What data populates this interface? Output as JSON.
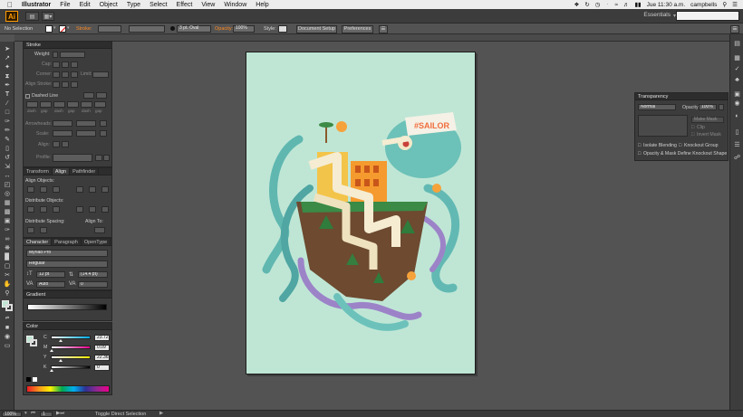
{
  "menubar": {
    "app_name": "Illustrator",
    "items": [
      "File",
      "Edit",
      "Object",
      "Type",
      "Select",
      "Effect",
      "View",
      "Window",
      "Help"
    ],
    "clock": "Jue 11:30 a.m.",
    "user": "campbells"
  },
  "appbar": {
    "logo_text": "Ai",
    "workspace": "Essentials"
  },
  "control_bar": {
    "selection": "No Selection",
    "stroke_label": "Stroke:",
    "brush": "3 pt. Oval",
    "opacity_label": "Opacity:",
    "opacity_value": "100%",
    "style_label": "Style:",
    "document_setup": "Document Setup",
    "preferences": "Preferences"
  },
  "stroke_panel": {
    "title": "Stroke",
    "weight_label": "Weight:",
    "cap_label": "Cap:",
    "corner_label": "Corner:",
    "limit_label": "Limit:",
    "align_stroke_label": "Align Stroke:",
    "dashed_line_label": "Dashed Line",
    "dash_labels": [
      "dash",
      "gap",
      "dash",
      "gap",
      "dash",
      "gap"
    ],
    "arrowheads_label": "Arrowheads:",
    "scale_label": "Scale:",
    "align_label": "Align:",
    "profile_label": "Profile:"
  },
  "align_panel": {
    "tabs": [
      "Transform",
      "Align",
      "Pathfinder"
    ],
    "align_objects_label": "Align Objects:",
    "distribute_objects_label": "Distribute Objects:",
    "distribute_spacing_label": "Distribute Spacing:",
    "align_to_label": "Align To:"
  },
  "character_panel": {
    "tabs": [
      "Character",
      "Paragraph",
      "OpenType"
    ],
    "font_family": "Myriad Pro",
    "font_style": "Regular",
    "font_size": "12 pt",
    "leading": "(14.4 pt)",
    "kerning": "Auto",
    "tracking": "0"
  },
  "gradient_panel": {
    "title": "Gradient"
  },
  "color_panel": {
    "title": "Color",
    "channels": [
      {
        "label": "C",
        "value": "23.72",
        "fraction": 0.2372
      },
      {
        "label": "M",
        "value": "0.09",
        "fraction": 0.0009
      },
      {
        "label": "Y",
        "value": "22.36",
        "fraction": 0.2236
      },
      {
        "label": "K",
        "value": "0",
        "fraction": 0
      }
    ],
    "swatch_color": "#c1e5d4"
  },
  "transparency_panel": {
    "title": "Transparency",
    "blend_mode": "Normal",
    "opacity_label": "Opacity:",
    "opacity_value": "100%",
    "make_mask": "Make Mask",
    "clip_label": "Clip",
    "invert_mask_label": "Invert Mask",
    "isolate_blending": "Isolate Blending",
    "knockout_group": "Knockout Group",
    "opacity_mask_label": "Opacity & Mask Define Knockout Shape"
  },
  "artwork": {
    "badge_text": "#SAILOR",
    "background_color": "#bfe6d5"
  },
  "status_bar": {
    "zoom": "100%",
    "page": "1",
    "tool_hint": "Toggle Direct Selection"
  },
  "colors": {
    "accent": "#ff9a00",
    "panel": "#3c3c3c",
    "workspace": "#535353"
  }
}
